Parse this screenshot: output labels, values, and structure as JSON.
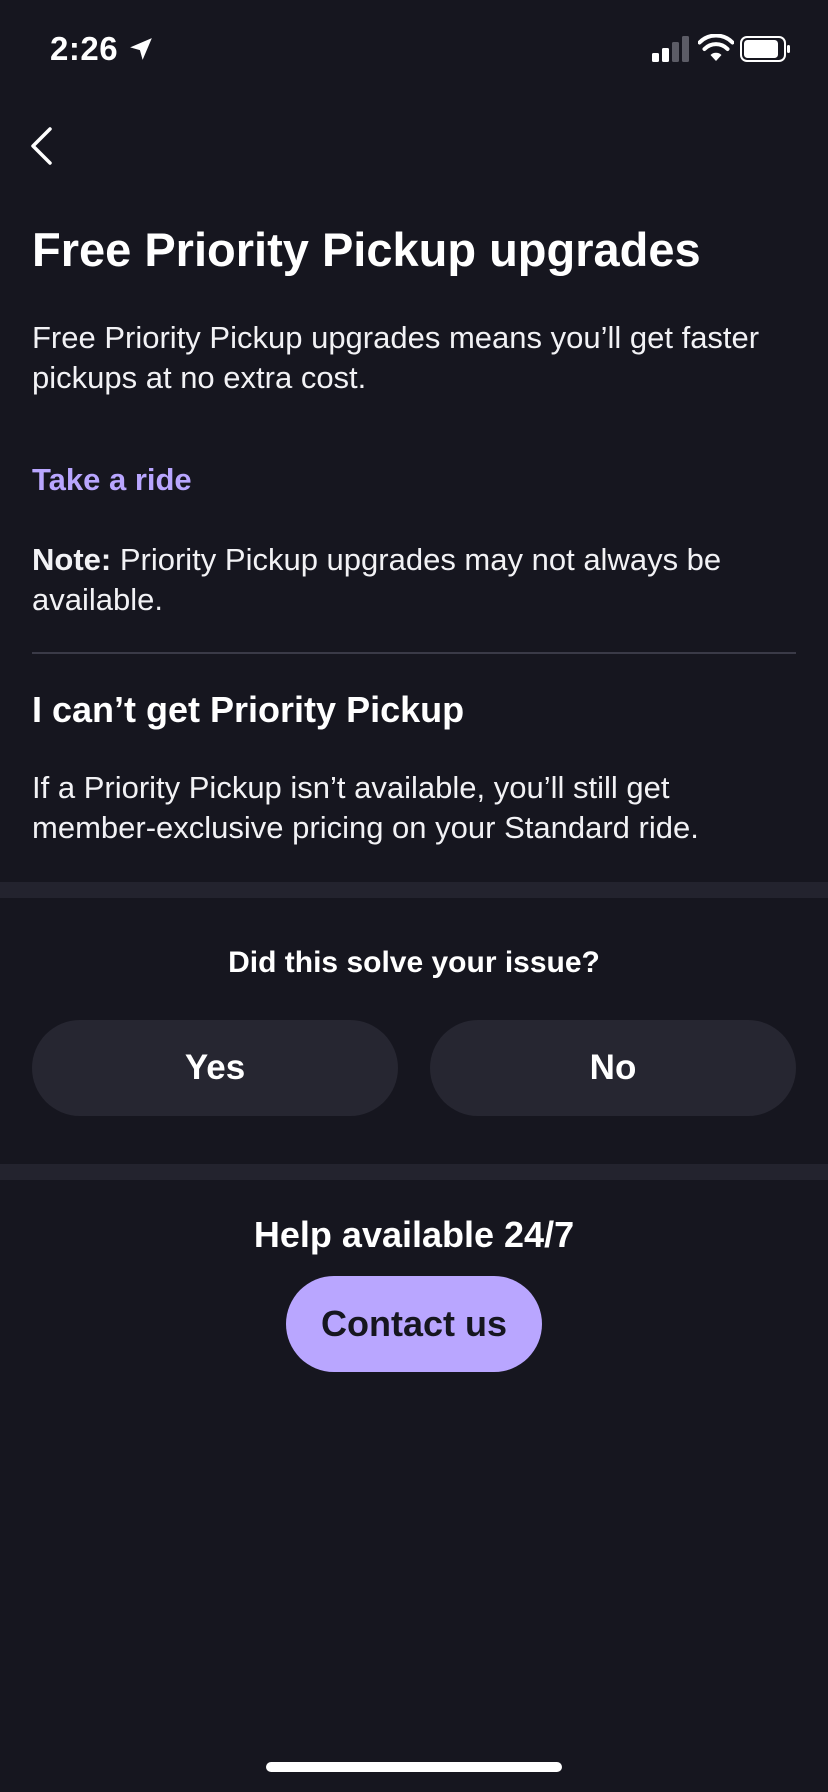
{
  "status_bar": {
    "time": "2:26"
  },
  "nav": {
    "back_icon": "chevron-left-icon"
  },
  "article": {
    "title": "Free Priority Pickup upgrades",
    "intro": "Free Priority Pickup upgrades means you’ll get faster pickups at no extra cost.",
    "link_label": "Take a ride",
    "note_label": "Note:",
    "note_text": " Priority Pickup upgrades may not always be available.",
    "section_heading": "I can’t get Priority Pickup",
    "section_text": "If a Priority Pickup isn’t available, you’ll still get member-exclusive pricing on your Standard ride."
  },
  "feedback": {
    "question": "Did this solve your issue?",
    "yes_label": "Yes",
    "no_label": "No"
  },
  "help": {
    "heading": "Help available 24/7",
    "contact_label": "Contact us"
  },
  "colors": {
    "background": "#16161f",
    "accent": "#b9a6ff",
    "button_surface": "#262631"
  }
}
